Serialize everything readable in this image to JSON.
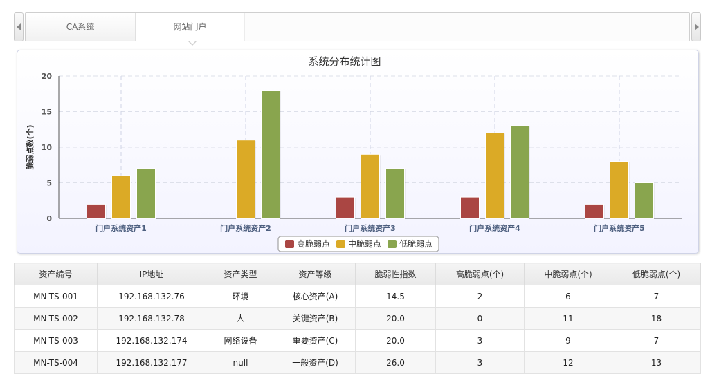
{
  "tabs": [
    {
      "label": "CA系统"
    },
    {
      "label": "网站门户"
    }
  ],
  "active_tab_index": 1,
  "chart_data": {
    "type": "bar",
    "title": "系统分布统计图",
    "ylabel": "脆弱点数(个)",
    "xlabel": "",
    "ylim": [
      0,
      20
    ],
    "yticks": [
      "0",
      "5",
      "10",
      "15",
      "20"
    ],
    "categories": [
      "门户系统资产1",
      "门户系统资产2",
      "门户系统资产3",
      "门户系统资产4",
      "门户系统资产5"
    ],
    "series": [
      {
        "name": "高脆弱点",
        "color": "#aa4643",
        "values": [
          2,
          0,
          3,
          3,
          2
        ]
      },
      {
        "name": "中脆弱点",
        "color": "#dbaa26",
        "values": [
          6,
          11,
          9,
          12,
          8
        ]
      },
      {
        "name": "低脆弱点",
        "color": "#89a54e",
        "values": [
          7,
          18,
          7,
          13,
          5
        ]
      }
    ],
    "grid": true,
    "legend": "bottom-center"
  },
  "table": {
    "headers": [
      "资产编号",
      "IP地址",
      "资产类型",
      "资产等级",
      "脆弱性指数",
      "高脆弱点(个)",
      "中脆弱点(个)",
      "低脆弱点(个)"
    ],
    "rows": [
      [
        "MN-TS-001",
        "192.168.132.76",
        "环境",
        "核心资产(A)",
        "14.5",
        "2",
        "6",
        "7"
      ],
      [
        "MN-TS-002",
        "192.168.132.78",
        "人",
        "关键资产(B)",
        "20.0",
        "0",
        "11",
        "18"
      ],
      [
        "MN-TS-003",
        "192.168.132.174",
        "网络设备",
        "重要资产(C)",
        "20.0",
        "3",
        "9",
        "7"
      ],
      [
        "MN-TS-004",
        "192.168.132.177",
        "null",
        "一般资产(D)",
        "26.0",
        "3",
        "12",
        "13"
      ]
    ]
  }
}
